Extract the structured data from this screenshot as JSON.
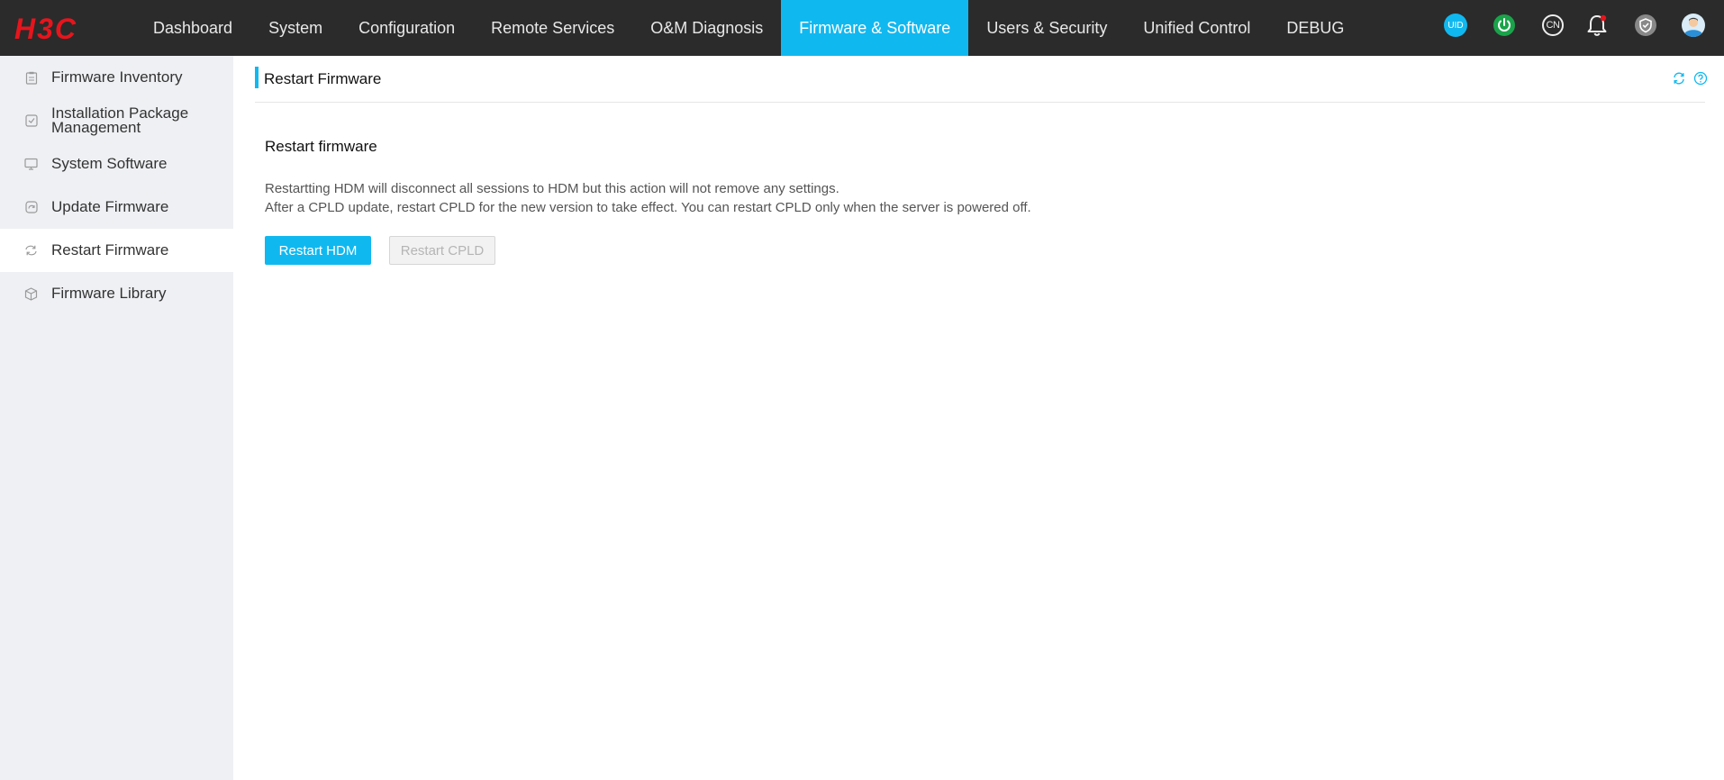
{
  "brand": {
    "logo_text": "H3C",
    "logo_color": "#e8141c"
  },
  "colors": {
    "accent": "#10b8f0",
    "topbar_bg": "#2b2b2b",
    "sidebar_bg": "#eef0f3",
    "power_green": "#1aa34a"
  },
  "nav": {
    "items": [
      {
        "label": "Dashboard"
      },
      {
        "label": "System"
      },
      {
        "label": "Configuration"
      },
      {
        "label": "Remote Services"
      },
      {
        "label": "O&M Diagnosis"
      },
      {
        "label": "Firmware & Software",
        "active": true
      },
      {
        "label": "Users & Security"
      },
      {
        "label": "Unified Control"
      },
      {
        "label": "DEBUG"
      }
    ]
  },
  "header_icons": {
    "uid_text": "UID",
    "language_text": "CN",
    "icons": [
      "uid-icon",
      "power-icon",
      "language-icon",
      "bell-icon",
      "shield-icon",
      "user-avatar-icon"
    ]
  },
  "sidebar": {
    "items": [
      {
        "label": "Firmware Inventory",
        "icon": "clipboard-icon"
      },
      {
        "label": "Installation Package Management",
        "icon": "package-icon"
      },
      {
        "label": "System Software",
        "icon": "monitor-icon"
      },
      {
        "label": "Update Firmware",
        "icon": "update-icon"
      },
      {
        "label": "Restart Firmware",
        "icon": "restart-icon",
        "active": true
      },
      {
        "label": "Firmware Library",
        "icon": "cube-icon"
      }
    ]
  },
  "page": {
    "title": "Restart Firmware",
    "section_title": "Restart firmware",
    "description_line1": "Restartting HDM will disconnect all sessions to HDM but this action will not remove any settings.",
    "description_line2": "After a CPLD update, restart CPLD for the new version to take effect. You can restart CPLD only when the server is powered off.",
    "restart_hdm_label": "Restart HDM",
    "restart_cpld_label": "Restart CPLD",
    "restart_cpld_enabled": false
  }
}
